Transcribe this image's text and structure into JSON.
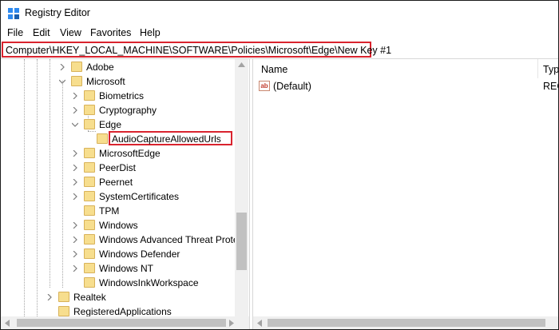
{
  "window": {
    "title": "Registry Editor"
  },
  "menu": [
    "File",
    "Edit",
    "View",
    "Favorites",
    "Help"
  ],
  "address": "Computer\\HKEY_LOCAL_MACHINE\\SOFTWARE\\Policies\\Microsoft\\Edge\\New Key #1",
  "tree": {
    "items": [
      {
        "label": "Adobe",
        "expander": "collapsed"
      },
      {
        "label": "Microsoft",
        "expander": "expanded"
      },
      {
        "label": "Biometrics",
        "expander": "collapsed"
      },
      {
        "label": "Cryptography",
        "expander": "collapsed"
      },
      {
        "label": "Edge",
        "expander": "expanded"
      },
      {
        "label": "AudioCaptureAllowedUrls",
        "expander": "none",
        "editing": true
      },
      {
        "label": "MicrosoftEdge",
        "expander": "collapsed"
      },
      {
        "label": "PeerDist",
        "expander": "collapsed"
      },
      {
        "label": "Peernet",
        "expander": "collapsed"
      },
      {
        "label": "SystemCertificates",
        "expander": "collapsed"
      },
      {
        "label": "TPM",
        "expander": "none"
      },
      {
        "label": "Windows",
        "expander": "collapsed"
      },
      {
        "label": "Windows Advanced Threat Prote",
        "expander": "collapsed"
      },
      {
        "label": "Windows Defender",
        "expander": "collapsed"
      },
      {
        "label": "Windows NT",
        "expander": "collapsed"
      },
      {
        "label": "WindowsInkWorkspace",
        "expander": "none"
      },
      {
        "label": "Realtek",
        "expander": "collapsed"
      },
      {
        "label": "RegisteredApplications",
        "expander": "none"
      }
    ]
  },
  "list": {
    "columns": [
      "Name",
      "Typ"
    ],
    "rows": [
      {
        "name": "(Default)",
        "type": "REG"
      }
    ]
  },
  "colors": {
    "highlight": "#d9232e",
    "folder": "#f7de8e",
    "accent": "#0078d7"
  },
  "icons": [
    "regedit-icon",
    "folder-icon",
    "string-value-icon",
    "chevron-right-icon",
    "chevron-down-icon"
  ]
}
